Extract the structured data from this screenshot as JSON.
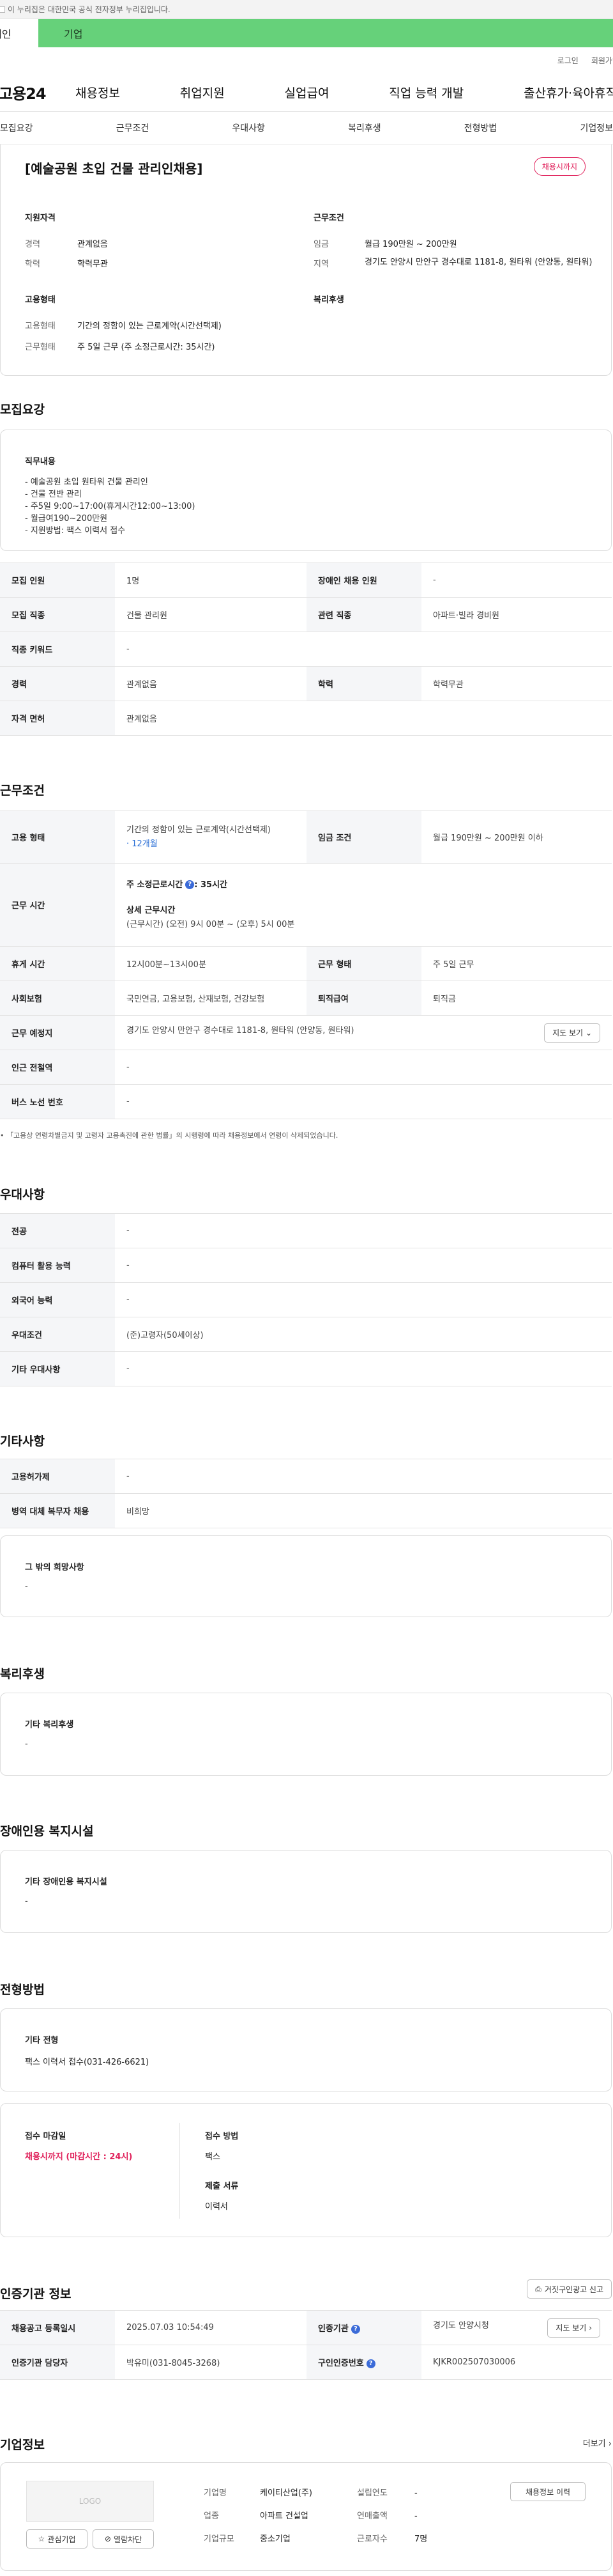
{
  "gov_bar": {
    "text": "이 누리집은 대한민국 공식 전자정부 누리집입니다."
  },
  "portal_tabs": {
    "person": "개인",
    "company": "기업"
  },
  "util_links": {
    "login": "로그인",
    "signup": "회원가입"
  },
  "gnb": {
    "logo": "고용24",
    "menu": [
      "채용정보",
      "취업지원",
      "실업급여",
      "직업 능력 개발",
      "출산휴가·육아휴직"
    ]
  },
  "subnav": [
    "모집요강",
    "근무조건",
    "우대사항",
    "복리후생",
    "전형방법",
    "기업정보"
  ],
  "job": {
    "title": "[예술공원 초입 건물 관리인채용]",
    "badge": "채용시까지",
    "summary": {
      "qual_title": "지원자격",
      "career_label": "경력",
      "career_value": "관계없음",
      "edu_label": "학력",
      "edu_value": "학력무관",
      "cond_title": "근무조건",
      "wage_label": "임금",
      "wage_value": "월급 190만원 ~ 200만원",
      "region_label": "지역",
      "region_value": "경기도 안양시 만안구 경수대로 1181-8, 원타워 (안양동, 원타워)",
      "emp_title": "고용형태",
      "emp_type_label": "고용형태",
      "emp_type_value": "기간의 정함이 있는 근로계약(시간선택제)",
      "work_type_label": "근무형태",
      "work_type_value": "주 5일 근무 (주 소정근로시간: 35시간)",
      "welfare_title": "복리후생"
    }
  },
  "recruit": {
    "title": "모집요강",
    "duty_title": "직무내용",
    "duty_lines": [
      "- 예술공원 초입 원타워 건물 관리인",
      "- 건물 전반 관리",
      "- 주5일 9:00~17:00(휴게시간12:00~13:00)",
      "- 월급여190~200만원",
      "- 지원방법: 팩스 이력서 접수"
    ],
    "rows": [
      {
        "h1": "모집 인원",
        "v1": "1명",
        "h2": "장애인 채용 인원",
        "v2": "-"
      },
      {
        "h1": "모집 직종",
        "v1": "건물 관리원",
        "h2": "관련 직종",
        "v2": "아파트·빌라 경비원"
      },
      {
        "h1": "직종 키워드",
        "v1": "-",
        "h2": "",
        "v2": ""
      },
      {
        "h1": "경력",
        "v1": "관계없음",
        "h2": "학력",
        "v2": "학력무관"
      },
      {
        "h1": "자격 면허",
        "v1": "관계없음",
        "h2": "",
        "v2": ""
      }
    ]
  },
  "conditions": {
    "title": "근무조건",
    "emp_h": "고용 형태",
    "emp_v": "기간의 정함이 있는 근로계약(시간선택제)",
    "emp_period": "· 12개월",
    "wage_h": "임금 조건",
    "wage_v": "월급 190만원 ~ 200만원 이하",
    "time_h": "근무 시간",
    "time_weekly": "주 소정근로시간",
    "time_weekly_val": ": 35시간",
    "time_detail_title": "상세 근무시간",
    "time_detail": "(근무시간) (오전) 9시 00분 ~ (오후) 5시 00분",
    "break_h": "휴게 시간",
    "break_v": "12시00분~13시00분",
    "worktype_h": "근무 형태",
    "worktype_v": "주 5일 근무",
    "insure_h": "사회보험",
    "insure_v": "국민연금, 고용보험, 산재보험, 건강보험",
    "retire_h": "퇴직급여",
    "retire_v": "퇴직금",
    "place_h": "근무 예정지",
    "place_v": "경기도 안양시 만안구 경수대로 1181-8, 원타워 (안양동, 원타워)",
    "map_btn": "지도 보기",
    "subway_h": "인근 전철역",
    "subway_v": "-",
    "bus_h": "버스 노선 번호",
    "bus_v": "-",
    "note": "「고용상 연령차별금지 및 고령자 고용촉진에 관한 법률」의 시행령에 따라 채용정보에서 연령이 삭제되었습니다."
  },
  "prefer": {
    "title": "우대사항",
    "rows": [
      {
        "h": "전공",
        "v": "-"
      },
      {
        "h": "컴퓨터 활용 능력",
        "v": "-"
      },
      {
        "h": "외국어 능력",
        "v": "-"
      },
      {
        "h": "우대조건",
        "v": "(준)고령자(50세이상)"
      },
      {
        "h": "기타 우대사항",
        "v": "-"
      }
    ]
  },
  "etc": {
    "title": "기타사항",
    "rows": [
      {
        "h": "고용허가제",
        "v": "-"
      },
      {
        "h": "병역 대체 복무자 채용",
        "v": "비희망"
      }
    ],
    "other_title": "그 밖의 희망사항",
    "other_value": "-"
  },
  "welfare": {
    "title": "복리후생",
    "box_title": "기타 복리후생",
    "box_value": "-"
  },
  "disability": {
    "title": "장애인용 복지시설",
    "box_title": "기타 장애인용 복지시설",
    "box_value": "-"
  },
  "selection": {
    "title": "전형방법",
    "box_title": "기타 전형",
    "box_value": "팩스 이력서 접수(031-426-6621)",
    "deadline_title": "접수 마감일",
    "deadline_value": "채용시까지 (마감시간 : 24시)",
    "method_title": "접수 방법",
    "method_value": "팩스",
    "docs_title": "제출 서류",
    "docs_value": "이력서"
  },
  "agency": {
    "title": "인증기관 정보",
    "report_btn": "거짓구인광고 신고",
    "reg_h": "채용공고 등록일시",
    "reg_v": "2025.07.03 10:54:49",
    "org_h": "인증기관",
    "org_v": "경기도 안양시청",
    "map_btn": "지도 보기",
    "staff_h": "인증기관 담당자",
    "staff_v": "박유미(031-8045-3268)",
    "num_h": "구인인증번호",
    "num_v": "KJKR002507030006"
  },
  "company": {
    "title": "기업정보",
    "more": "더보기",
    "logo": "LOGO",
    "interest_btn": "관심기업",
    "block_btn": "열람차단",
    "name_label": "기업명",
    "name_value": "케이티산업(주)",
    "year_label": "설립연도",
    "year_value": "-",
    "industry_label": "업종",
    "industry_value": "아파트 건설업",
    "sales_label": "연매출액",
    "sales_value": "-",
    "size_label": "기업규모",
    "size_value": "중소기업",
    "staff_label": "근로자수",
    "staff_value": "7명",
    "list_btn": "채용정보 이력"
  }
}
